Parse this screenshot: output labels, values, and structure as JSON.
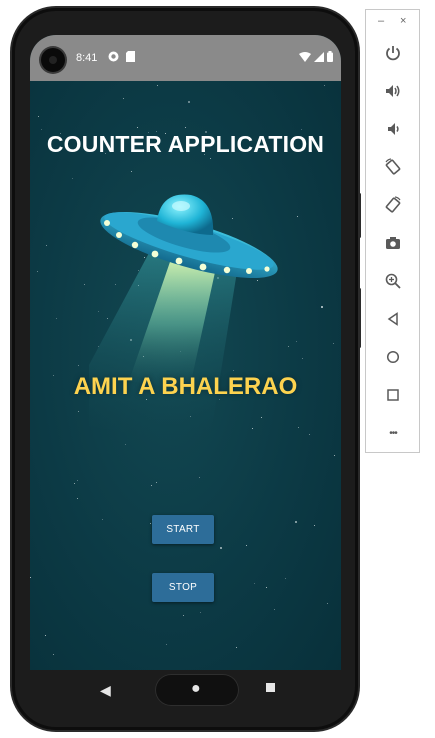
{
  "status_bar": {
    "time": "8:41",
    "left_icons": [
      "app-notification-icon",
      "sim-card-icon"
    ],
    "right_icons": [
      "wifi-icon",
      "cell-signal-icon",
      "battery-icon"
    ]
  },
  "app": {
    "title": "COUNTER APPLICATION",
    "name": "AMIT A BHALERAO",
    "buttons": {
      "start_label": "START",
      "stop_label": "STOP"
    },
    "colors": {
      "background": "#0c3945",
      "name_text": "#fdd34f",
      "button": "#2d6d99"
    }
  },
  "navigation": {
    "back": "◀",
    "home": "●",
    "recents": "■"
  },
  "emulator_toolbar": {
    "minimize": "–",
    "close": "×",
    "items": [
      "power-icon",
      "volume-up-icon",
      "volume-down-icon",
      "rotate-left-icon",
      "rotate-right-icon",
      "screenshot-icon",
      "zoom-icon",
      "back-icon",
      "home-icon",
      "overview-icon",
      "more-icon"
    ],
    "more": "•••"
  }
}
